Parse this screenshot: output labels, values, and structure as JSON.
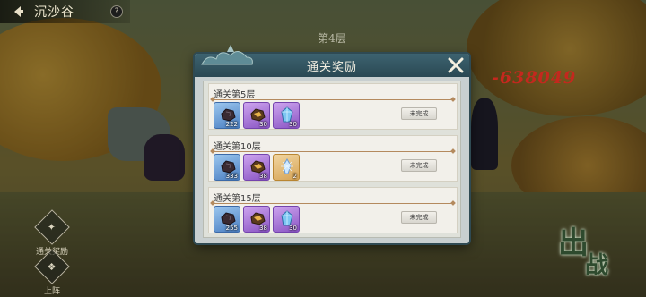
{
  "header": {
    "stage_name": "沉沙谷",
    "help_label": "?"
  },
  "floor_banner": "第4层",
  "damage_text": "-638049",
  "side_buttons": [
    {
      "label": "通关奖励",
      "icon": "trophy-icon"
    },
    {
      "label": "上阵",
      "icon": "formation-icon"
    }
  ],
  "fight_button": {
    "char1": "出",
    "char2": "战"
  },
  "modal": {
    "title": "通关奖励",
    "close_icon": "close-icon",
    "rewards": [
      {
        "title": "通关第5层",
        "status": "未完成",
        "items": [
          {
            "icon": "iron-ore-icon",
            "rarity": "blue",
            "count": "222"
          },
          {
            "icon": "gold-ore-icon",
            "rarity": "purple",
            "count": "30"
          },
          {
            "icon": "crystal-icon",
            "rarity": "purple",
            "count": "30"
          }
        ]
      },
      {
        "title": "通关第10层",
        "status": "未完成",
        "items": [
          {
            "icon": "iron-ore-icon",
            "rarity": "blue",
            "count": "333"
          },
          {
            "icon": "gold-ore-icon",
            "rarity": "purple",
            "count": "38"
          },
          {
            "icon": "frost-crystal-icon",
            "rarity": "gold",
            "count": "2"
          }
        ]
      },
      {
        "title": "通关第15层",
        "status": "未完成",
        "items": [
          {
            "icon": "iron-ore-icon",
            "rarity": "blue",
            "count": "255"
          },
          {
            "icon": "gold-ore-icon",
            "rarity": "purple",
            "count": "38"
          },
          {
            "icon": "crystal-icon",
            "rarity": "purple",
            "count": "30"
          }
        ]
      }
    ]
  }
}
